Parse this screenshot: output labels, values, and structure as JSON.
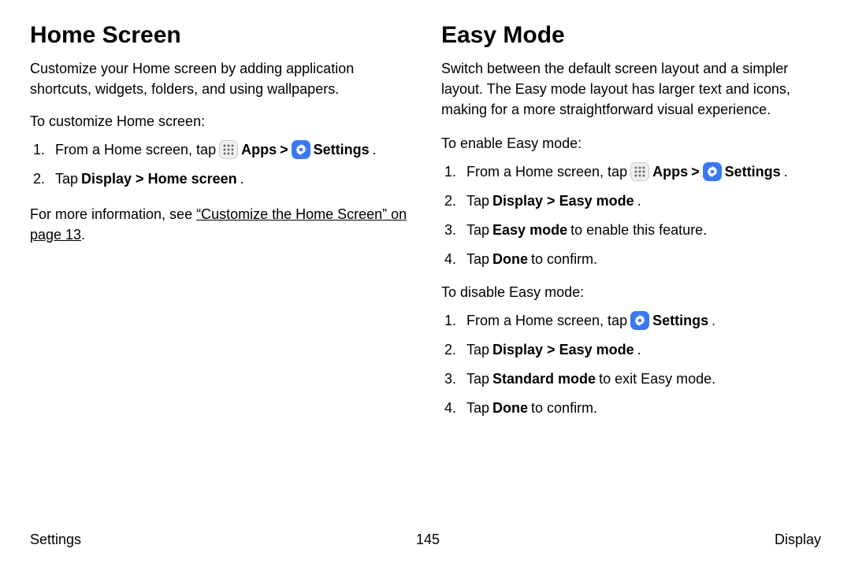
{
  "left": {
    "heading": "Home Screen",
    "intro": "Customize your Home screen by adding application shortcuts, widgets, folders, and using wallpapers.",
    "lead": "To customize Home screen:",
    "steps": [
      {
        "num": "1.",
        "pre": "From a Home screen, tap",
        "apps_label": "Apps",
        "sep": " > ",
        "settings_label": "Settings",
        "post": "."
      },
      {
        "num": "2.",
        "text_pre": "Tap ",
        "bold": "Display > Home screen",
        "text_post": "."
      }
    ],
    "more_pre": "For more information, see ",
    "more_link": "“Customize the Home Screen” on page 13",
    "more_post": "."
  },
  "right": {
    "heading": "Easy Mode",
    "intro": "Switch between the default screen layout and a simpler layout. The Easy mode layout has larger text and icons, making for a more straightforward visual experience.",
    "lead1": "To enable Easy mode:",
    "enable_steps": [
      {
        "num": "1.",
        "pre": "From a Home screen, tap",
        "apps_label": "Apps",
        "sep": " > ",
        "settings_label": "Settings",
        "post": "."
      },
      {
        "num": "2.",
        "text_pre": "Tap ",
        "bold": "Display > Easy mode",
        "text_post": "."
      },
      {
        "num": "3.",
        "text_pre": "Tap ",
        "bold": "Easy mode",
        "text_post": " to enable this feature."
      },
      {
        "num": "4.",
        "text_pre": "Tap ",
        "bold": "Done",
        "text_post": " to confirm."
      }
    ],
    "lead2": "To disable Easy mode:",
    "disable_steps": [
      {
        "num": "1.",
        "pre": "From a Home screen, tap",
        "settings_label": "Settings",
        "post": "."
      },
      {
        "num": "2.",
        "text_pre": "Tap ",
        "bold": "Display > Easy mode",
        "text_post": "."
      },
      {
        "num": "3.",
        "text_pre": "Tap ",
        "bold": "Standard mode",
        "text_post": " to exit Easy mode."
      },
      {
        "num": "4.",
        "text_pre": "Tap ",
        "bold": "Done",
        "text_post": " to confirm."
      }
    ]
  },
  "footer": {
    "left": "Settings",
    "center": "145",
    "right": "Display"
  }
}
